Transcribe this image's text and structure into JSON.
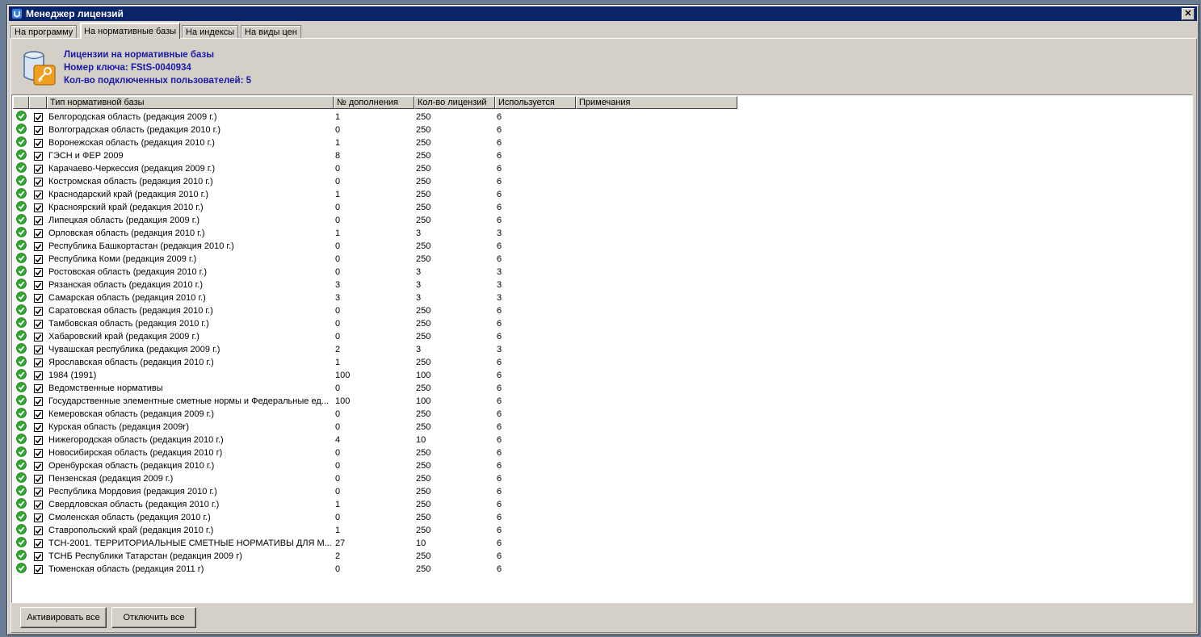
{
  "window": {
    "title": "Менеджер лицензий"
  },
  "tabs": [
    {
      "label": "На программу",
      "active": false
    },
    {
      "label": "На нормативные базы",
      "active": true
    },
    {
      "label": "На индексы",
      "active": false
    },
    {
      "label": "На виды цен",
      "active": false
    }
  ],
  "info": {
    "line1": "Лицензии на нормативные базы",
    "line2": "Номер ключа: FStS-0040934",
    "line3": "Кол-во подключенных пользователей: 5"
  },
  "columns": [
    "",
    "",
    "Тип нормативной базы",
    "№ дополнения",
    "Кол-во лицензий",
    "Используется",
    "Примечания"
  ],
  "rows": [
    [
      "Белгородская область (редакция 2009 г.)",
      "1",
      "250",
      "6"
    ],
    [
      "Волгоградская область  (редакция 2010 г.)",
      "0",
      "250",
      "6"
    ],
    [
      "Воронежская область (редакция 2010 г.)",
      "1",
      "250",
      "6"
    ],
    [
      "ГЭСН и ФЕР 2009",
      "8",
      "250",
      "6"
    ],
    [
      "Карачаево-Черкессия (редакция 2009 г.)",
      "0",
      "250",
      "6"
    ],
    [
      "Костромская область  (редакция 2010 г.)",
      "0",
      "250",
      "6"
    ],
    [
      "Краснодарский край (редакция 2010 г.)",
      "1",
      "250",
      "6"
    ],
    [
      "Красноярский край  (редакция 2010 г.)",
      "0",
      "250",
      "6"
    ],
    [
      "Липецкая область (редакция 2009 г.)",
      "0",
      "250",
      "6"
    ],
    [
      "Орловская область (редакция 2010 г.)",
      "1",
      "3",
      "3"
    ],
    [
      "Республика Башкортастан (редакция 2010 г.)",
      "0",
      "250",
      "6"
    ],
    [
      "Республика Коми (редакция 2009 г.)",
      "0",
      "250",
      "6"
    ],
    [
      "Ростовская область  (редакция 2010 г.)",
      "0",
      "3",
      "3"
    ],
    [
      "Рязанская область (редакция 2010 г.)",
      "3",
      "3",
      "3"
    ],
    [
      "Самарская область (редакция 2010 г.)",
      "3",
      "3",
      "3"
    ],
    [
      "Саратовская область (редакция 2010 г.)",
      "0",
      "250",
      "6"
    ],
    [
      "Тамбовская область  (редакция 2010 г.)",
      "0",
      "250",
      "6"
    ],
    [
      "Хабаровский край  (редакция 2009 г.)",
      "0",
      "250",
      "6"
    ],
    [
      "Чувашская республика (редакция 2009 г.)",
      "2",
      "3",
      "3"
    ],
    [
      "Ярославская область (редакция 2010 г.)",
      "1",
      "250",
      "6"
    ],
    [
      "1984 (1991)",
      "100",
      "100",
      "6"
    ],
    [
      "Ведомственные нормативы",
      "0",
      "250",
      "6"
    ],
    [
      "Государственные элементные сметные нормы и Федеральные ед...",
      "100",
      "100",
      "6"
    ],
    [
      "Кемеровская область (редакция 2009 г.)",
      "0",
      "250",
      "6"
    ],
    [
      "Курская область (редакция 2009г)",
      "0",
      "250",
      "6"
    ],
    [
      "Нижегородская область (редакция 2010 г.)",
      "4",
      "10",
      "6"
    ],
    [
      "Новосибирская область (редакция 2010 г)",
      "0",
      "250",
      "6"
    ],
    [
      "Оренбурская область (редакция 2010 г.)",
      "0",
      "250",
      "6"
    ],
    [
      "Пензенская (редакция 2009 г.)",
      "0",
      "250",
      "6"
    ],
    [
      "Республика Мордовия (редакция 2010 г.)",
      "0",
      "250",
      "6"
    ],
    [
      "Свердловская область (редакция 2010 г.)",
      "1",
      "250",
      "6"
    ],
    [
      "Смоленская область  (редакция 2010 г.)",
      "0",
      "250",
      "6"
    ],
    [
      "Ставропольский край (редакция 2010 г.)",
      "1",
      "250",
      "6"
    ],
    [
      "ТСН-2001. ТЕРРИТОРИАЛЬНЫЕ СМЕТНЫЕ НОРМАТИВЫ ДЛЯ М...",
      "27",
      "10",
      "6"
    ],
    [
      "ТСНБ Республики Татарстан (редакция 2009 г)",
      "2",
      "250",
      "6"
    ],
    [
      "Тюменская область (редакция 2011 г)",
      "0",
      "250",
      "6"
    ]
  ],
  "buttons": {
    "activate_all": "Активировать все",
    "deactivate_all": "Отключить все"
  },
  "icons": {
    "status": "green-check-icon",
    "checkbox": "checkbox-checked-icon",
    "header": "database-key-icon",
    "close": "close-icon"
  },
  "colors": {
    "titlebar": "#0a246a",
    "info_text": "#1a1aa6",
    "status_green": "#2ea82e"
  }
}
